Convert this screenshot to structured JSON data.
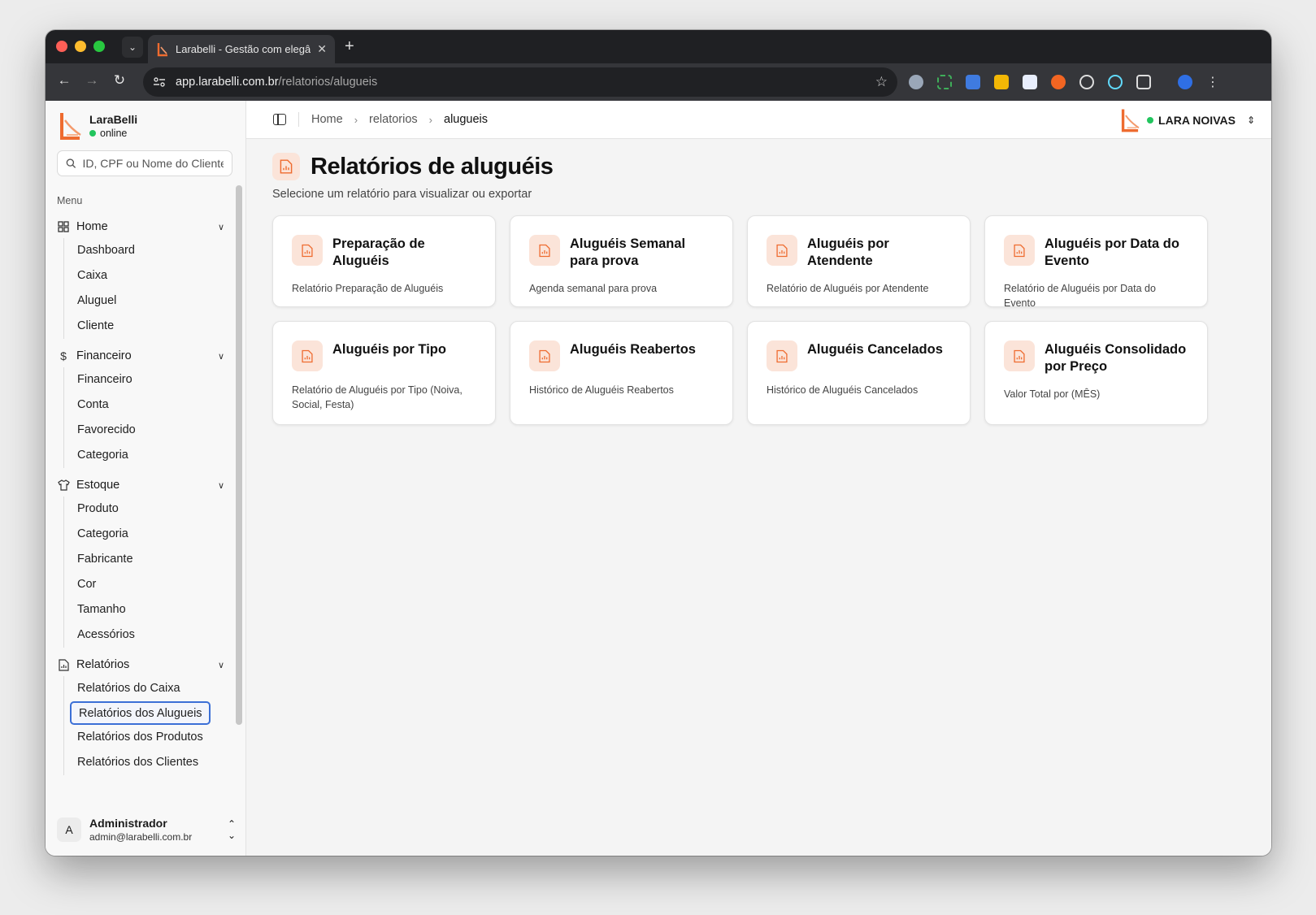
{
  "browser": {
    "tab_title": "Larabelli - Gestão com elegân",
    "url_host": "app.larabelli.com.br",
    "url_path": "/relatorios/alugueis"
  },
  "colors": {
    "accent_orange": "#ee6b2f",
    "accent_soft": "#fbe4d9",
    "online_green": "#22c55e",
    "focus_blue": "#3b6fd6"
  },
  "brand": {
    "name": "LaraBelli",
    "status": "online"
  },
  "search": {
    "placeholder": "ID, CPF ou Nome do Cliente",
    "value": ""
  },
  "menu": {
    "heading": "Menu",
    "groups": [
      {
        "label": "Home",
        "icon": "grid-icon",
        "items": [
          "Dashboard",
          "Caixa",
          "Aluguel",
          "Cliente"
        ]
      },
      {
        "label": "Financeiro",
        "icon": "dollar-icon",
        "items": [
          "Financeiro",
          "Conta",
          "Favorecido",
          "Categoria"
        ]
      },
      {
        "label": "Estoque",
        "icon": "shirt-icon",
        "items": [
          "Produto",
          "Categoria",
          "Fabricante",
          "Cor",
          "Tamanho",
          "Acessórios"
        ]
      },
      {
        "label": "Relatórios",
        "icon": "report-icon",
        "items": [
          "Relatórios do Caixa",
          "Relatórios dos Alugueis",
          "Relatórios dos Produtos",
          "Relatórios dos Clientes"
        ]
      }
    ],
    "active_item": "Relatórios dos Alugueis"
  },
  "user": {
    "initial": "A",
    "name": "Administrador",
    "email": "admin@larabelli.com.br"
  },
  "breadcrumb": [
    "Home",
    "relatorios",
    "alugueis"
  ],
  "store": {
    "name": "LARA NOIVAS"
  },
  "page": {
    "title": "Relatórios de aluguéis",
    "subtitle": "Selecione um relatório para visualizar ou exportar"
  },
  "reports": [
    {
      "title": "Preparação de Aluguéis",
      "desc": "Relatório Preparação de Aluguéis"
    },
    {
      "title": "Aluguéis Semanal para prova",
      "desc": "Agenda semanal para prova"
    },
    {
      "title": "Aluguéis por Atendente",
      "desc": "Relatório de Aluguéis por Atendente"
    },
    {
      "title": "Aluguéis por Data do Evento",
      "desc": "Relatório de Aluguéis por Data do Evento"
    },
    {
      "title": "Aluguéis por Tipo",
      "desc": "Relatório de Aluguéis por Tipo (Noiva, Social, Festa)"
    },
    {
      "title": "Aluguéis Reabertos",
      "desc": "Histórico de Aluguéis Reabertos"
    },
    {
      "title": "Aluguéis Cancelados",
      "desc": "Histórico de Aluguéis Cancelados"
    },
    {
      "title": "Aluguéis Consolidado por Preço",
      "desc": "Valor Total por (MÊS)"
    }
  ]
}
